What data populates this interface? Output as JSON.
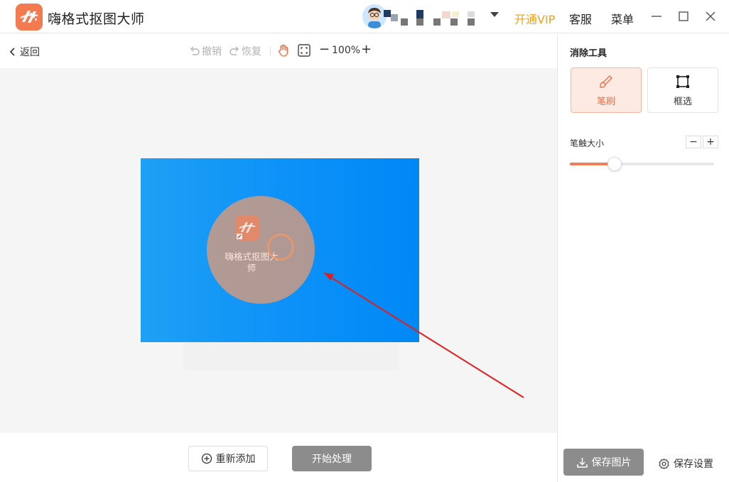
{
  "app": {
    "title": "嗨格式抠图大师",
    "user_name": "▇▆▇▆▇▆▇",
    "vip_label": "开通VIP",
    "service_label": "客服",
    "menu_label": "菜单",
    "brand_color": "#f47a4f",
    "vip_color": "#f0a01e"
  },
  "toolbar": {
    "back_label": "返回",
    "undo_label": "撤销",
    "redo_label": "恢复",
    "zoom_out_label": "−",
    "zoom_level": "100%",
    "zoom_in_label": "+"
  },
  "canvas": {
    "image_background": "#0c91f8",
    "desktop_icon_label": "嗨格式抠图大师"
  },
  "bottom": {
    "readd_label": "重新添加",
    "start_label": "开始处理"
  },
  "panel": {
    "title": "消除工具",
    "tools": [
      {
        "label": "笔刷",
        "icon": "brush-icon",
        "selected": true
      },
      {
        "label": "框选",
        "icon": "rect-select-icon",
        "selected": false
      }
    ],
    "size_label": "笔触大小",
    "size_minus": "−",
    "size_plus": "+",
    "brush_size_fraction": 0.31,
    "save_image_label": "保存图片",
    "save_settings_label": "保存设置",
    "accent_color": "#ee7f5a"
  }
}
